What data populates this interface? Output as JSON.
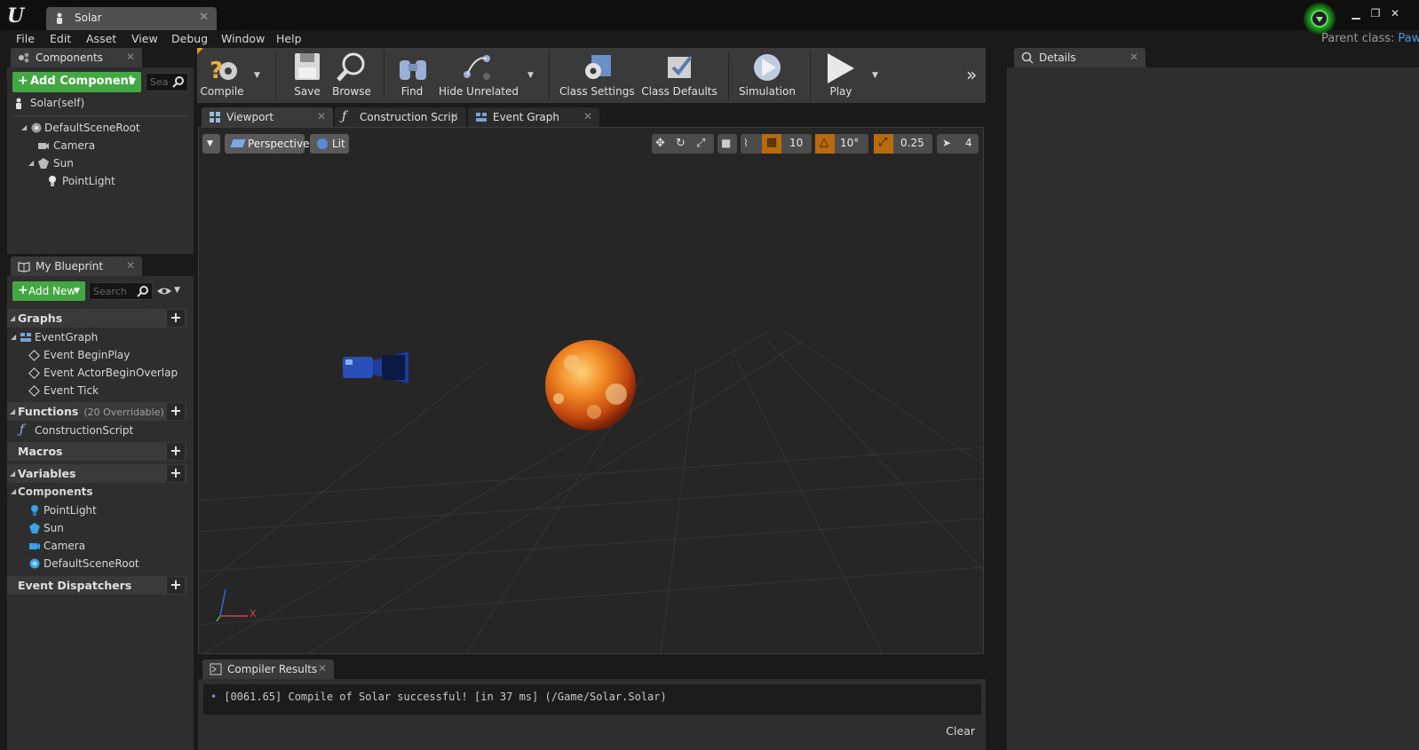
{
  "window": {
    "tab_title": "Solar",
    "parent_class_label": "Parent class:",
    "parent_class_value": "Pawn"
  },
  "menu": [
    "File",
    "Edit",
    "Asset",
    "View",
    "Debug",
    "Window",
    "Help"
  ],
  "components_panel": {
    "title": "Components",
    "add_button": "Add Component",
    "search_placeholder": "Sea",
    "self_label": "Solar(self)",
    "tree": [
      {
        "label": "DefaultSceneRoot",
        "icon": "scene-root-icon"
      },
      {
        "label": "Camera",
        "icon": "camera-icon"
      },
      {
        "label": "Sun",
        "icon": "static-mesh-icon"
      },
      {
        "label": "PointLight",
        "icon": "light-bulb-icon"
      }
    ]
  },
  "my_blueprint": {
    "title": "My Blueprint",
    "add_button": "Add New",
    "search_placeholder": "Search",
    "graphs_label": "Graphs",
    "event_graph_label": "EventGraph",
    "events": [
      "Event BeginPlay",
      "Event ActorBeginOverlap",
      "Event Tick"
    ],
    "functions_label": "Functions",
    "functions_sub": "(20 Overridable)",
    "construction_script": "ConstructionScript",
    "macros_label": "Macros",
    "variables_label": "Variables",
    "components_label": "Components",
    "component_vars": [
      "PointLight",
      "Sun",
      "Camera",
      "DefaultSceneRoot"
    ],
    "dispatchers_label": "Event Dispatchers"
  },
  "toolbar": {
    "compile": "Compile",
    "save": "Save",
    "browse": "Browse",
    "find": "Find",
    "hide_unrelated": "Hide Unrelated",
    "class_settings": "Class Settings",
    "class_defaults": "Class Defaults",
    "simulation": "Simulation",
    "play": "Play"
  },
  "editor_tabs": {
    "viewport": "Viewport",
    "construction": "Construction Scrip",
    "event_graph": "Event Graph"
  },
  "viewport": {
    "perspective": "Perspective",
    "lit": "Lit",
    "grid_snap": "10",
    "rotation_snap": "10°",
    "scale_snap": "0.25",
    "camera_speed": "4",
    "axis_x": "X"
  },
  "details": {
    "title": "Details"
  },
  "compiler": {
    "title": "Compiler Results",
    "message": "[0061.65] Compile of Solar successful! [in 37 ms] (/Game/Solar.Solar)",
    "clear": "Clear"
  },
  "colors": {
    "accent_green": "#43a843",
    "link_blue": "#4a9ade",
    "snap_orange": "#b86a0e"
  }
}
